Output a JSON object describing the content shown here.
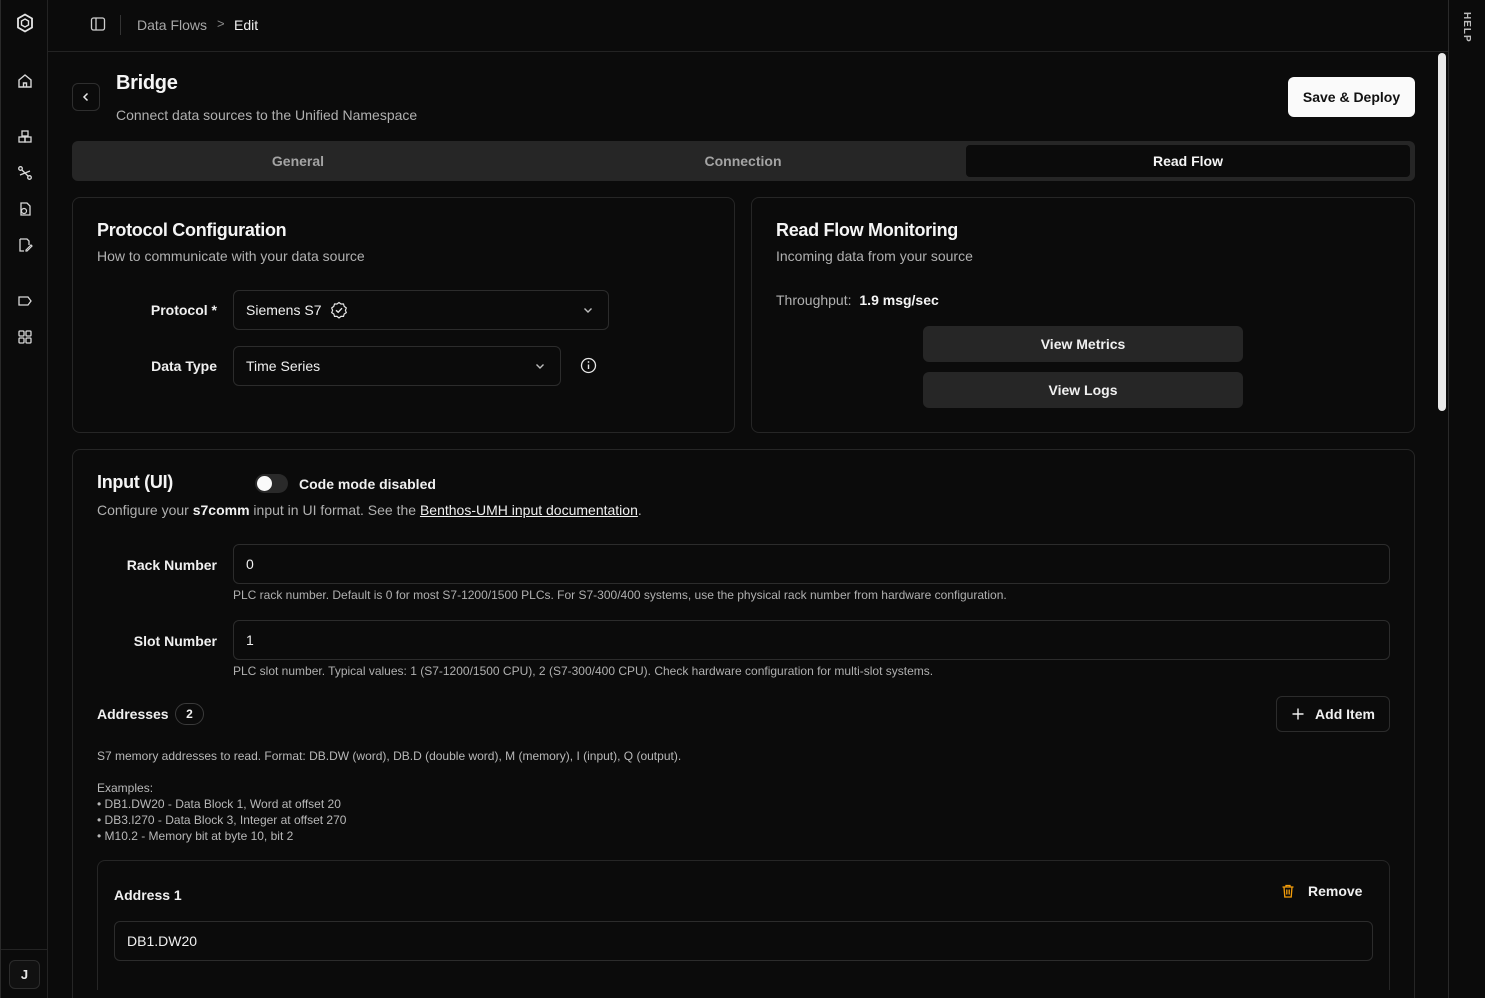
{
  "help_tab": "HELP",
  "user": {
    "initial": "J"
  },
  "breadcrumb": {
    "parent": "Data Flows",
    "separator": ">",
    "current": "Edit"
  },
  "header": {
    "title": "Bridge",
    "subtitle": "Connect data sources to the Unified Namespace",
    "deploy_label": "Save & Deploy"
  },
  "tabs": [
    {
      "label": "General"
    },
    {
      "label": "Connection"
    },
    {
      "label": "Read Flow",
      "active": true
    }
  ],
  "protocol_card": {
    "title": "Protocol Configuration",
    "subtitle": "How to communicate with your data source",
    "protocol_label": "Protocol *",
    "protocol_value": "Siemens S7",
    "datatype_label": "Data Type",
    "datatype_value": "Time Series"
  },
  "monitoring_card": {
    "title": "Read Flow Monitoring",
    "subtitle": "Incoming data from your source",
    "throughput_label": "Throughput:",
    "throughput_value": "1.9 msg/sec",
    "metrics_label": "View Metrics",
    "logs_label": "View Logs"
  },
  "input_card": {
    "title": "Input (UI)",
    "toggle_label": "Code mode disabled",
    "desc_prefix": "Configure your ",
    "desc_bold": "s7comm",
    "desc_middle": " input in UI format. See the ",
    "desc_link": "Benthos-UMH input documentation",
    "desc_suffix": ".",
    "rack_label": "Rack Number",
    "rack_value": "0",
    "rack_hint": "PLC rack number. Default is 0 for most S7-1200/1500 PLCs. For S7-300/400 systems, use the physical rack number from hardware configuration.",
    "slot_label": "Slot Number",
    "slot_value": "1",
    "slot_hint": "PLC slot number. Typical values: 1 (S7-1200/1500 CPU), 2 (S7-300/400 CPU). Check hardware configuration for multi-slot systems.",
    "addresses_label": "Addresses",
    "addresses_count": "2",
    "add_item_label": "Add Item",
    "addresses_help": [
      "S7 memory addresses to read. Format: DB.DW (word), DB.D (double word), M (memory), I (input), Q (output).",
      "",
      "Examples:",
      "• DB1.DW20 - Data Block 1, Word at offset 20",
      "• DB3.I270 - Data Block 3, Integer at offset 270",
      "• M10.2 - Memory bit at byte 10, bit 2"
    ],
    "address_items": [
      {
        "label": "Address 1",
        "value": "DB1.DW20",
        "remove_label": "Remove"
      }
    ]
  },
  "colors": {
    "accent_warning": "#f59e0b",
    "background": "#0b0b0b",
    "card_border": "#262626"
  }
}
